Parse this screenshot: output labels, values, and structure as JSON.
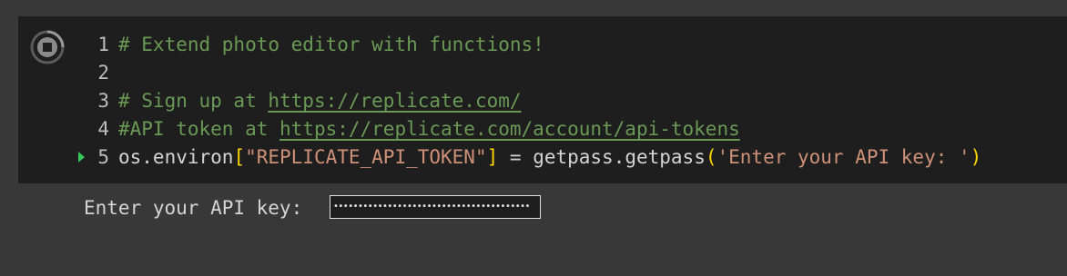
{
  "cell": {
    "run_button_icon": "stop-circle-icon",
    "lines": [
      {
        "num": "1",
        "comment": "# Extend photo editor with functions!"
      },
      {
        "num": "2"
      },
      {
        "num": "3",
        "comment_prefix": "# Sign up at ",
        "link": "https://replicate.com/"
      },
      {
        "num": "4",
        "comment_prefix": "#API token at ",
        "link": "https://replicate.com/account/api-tokens"
      },
      {
        "num": "5",
        "code_a": "os.environ",
        "bracket_open": "[",
        "key_string": "\"REPLICATE_API_TOKEN\"",
        "bracket_close": "]",
        "code_b": " = getpass.getpass",
        "paren_open": "(",
        "arg_string": "'Enter your API key: '",
        "paren_close": ")"
      }
    ]
  },
  "output": {
    "prompt_label": "Enter your API key: ",
    "password_masked": "••••••••••••••••••••••••••••••••••••••••"
  },
  "colors": {
    "cell_bg": "#1e1e1e",
    "page_bg": "#383838",
    "comment": "#6a9955",
    "string": "#ce9178",
    "bracket": "#ffd700",
    "exec_marker": "#34c759"
  }
}
